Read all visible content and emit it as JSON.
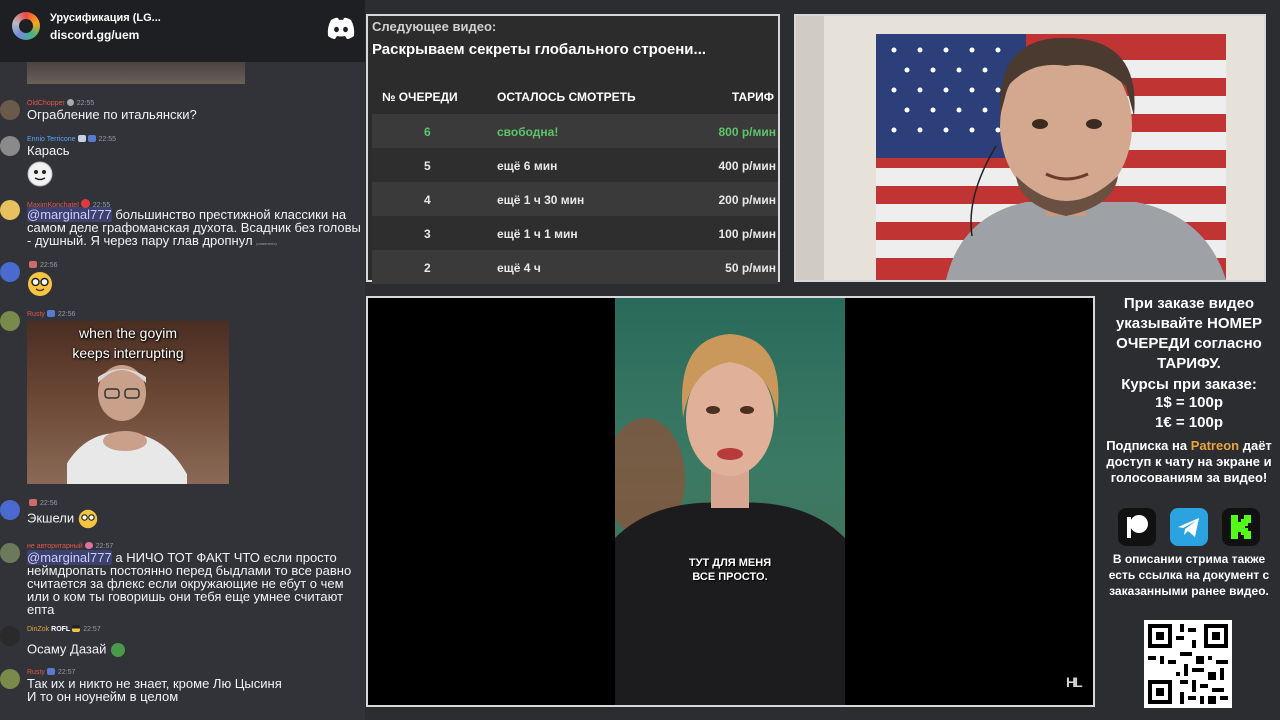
{
  "discord": {
    "server_name": "Урусификация (LG...",
    "invite": "discord.gg/uem",
    "messages": [
      {
        "user": "OldChopper",
        "time": "22:55",
        "text": "Ограбление по итальянски?",
        "color": "#e0584f"
      },
      {
        "user": "Ennio Terricone",
        "time": "22:55",
        "text": "Карась",
        "color": "#58a6ff"
      },
      {
        "user": "MaximKonchatel",
        "time": "22:55",
        "mention": "@marginal777",
        "text": " большинство престижной классики на самом деле графоманская духота. Всадник без головы - душный. Я через пару глав дропнул",
        "edited": "(изменено)",
        "color": "#e0584f"
      },
      {
        "user": "",
        "time": "22:56",
        "text": "",
        "color": "#949ba4"
      },
      {
        "user": "Rusty",
        "time": "22:56",
        "text": "",
        "color": "#e0584f"
      },
      {
        "user": "",
        "time": "22:56",
        "text": "Экшели",
        "color": "#949ba4"
      },
      {
        "user": "не авторитарный",
        "time": "22:57",
        "mention": "@marginal777",
        "text": " а НИЧО ТОТ ФАКТ ЧТО если просто неймдропать постоянно перед быдлами то все равно считается за флекс если окружающие не ебут о чем или о ком ты говоришь они тебя еще умнее считают епта",
        "color": "#e0584f"
      },
      {
        "user": "DinZok",
        "time": "22:57",
        "badge": "ROFL",
        "text": "Осаму Дазай",
        "color": "#e8a33c"
      },
      {
        "user": "Rusty",
        "time": "22:57",
        "text": "Так их и никто не знает, кроме Лю Цысиня\nИ то он ноунейм в целом",
        "color": "#e0584f"
      }
    ],
    "meme_caption": "when the goyim\nkeeps interrupting"
  },
  "queue": {
    "label": "Следующее видео:",
    "next_title": "Раскрываем секреты глобального строени...",
    "headers": [
      "№ ОЧЕРЕДИ",
      "ОСТАЛОСЬ СМОТРЕТЬ",
      "ТАРИФ"
    ],
    "rows": [
      {
        "num": "6",
        "remaining": "свободна!",
        "tariff": "800 р/мин"
      },
      {
        "num": "5",
        "remaining": "ещё 6 мин",
        "tariff": "400 р/мин"
      },
      {
        "num": "4",
        "remaining": "ещё 1 ч 30 мин",
        "tariff": "200 р/мин"
      },
      {
        "num": "3",
        "remaining": "ещё 1 ч 1 мин",
        "tariff": "100 р/мин"
      },
      {
        "num": "2",
        "remaining": "ещё 4 ч",
        "tariff": "50 р/мин"
      }
    ],
    "free_color": "#5ec46b"
  },
  "video": {
    "subtitle": "ТУТ ДЛЯ МЕНЯ\nВСЕ ПРОСТО.",
    "logo": "HL"
  },
  "info": {
    "order_text": "При заказе видео указывайте НОМЕР ОЧЕРЕДИ согласно ТАРИФУ.",
    "rates_title": "Курсы при заказе:",
    "rate_usd": "1$ = 100р",
    "rate_eur": "1€ = 100р",
    "sub_pre": "Подписка на ",
    "sub_patreon": "Patreon",
    "sub_post": " даёт доступ к чату на экране и голосованиям за видео!",
    "desc": "В описании стрима также есть ссылка на документ с заказанными ранее видео.",
    "socials": [
      "patreon-icon",
      "telegram-icon",
      "kick-icon"
    ]
  }
}
